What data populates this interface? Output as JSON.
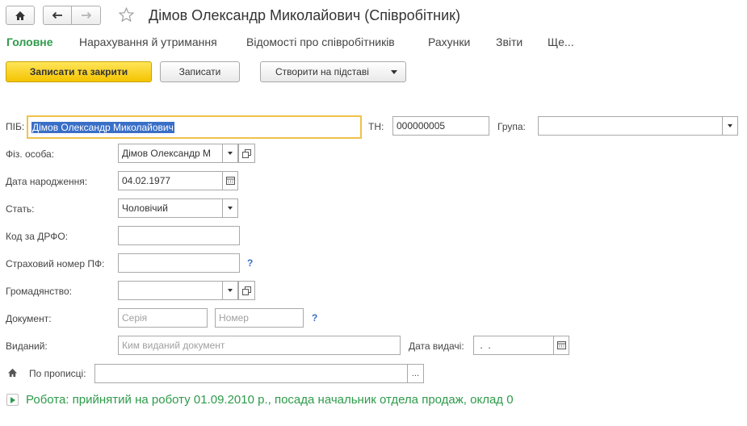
{
  "window": {
    "title": "Дімов Олександр Миколайович (Співробітник)"
  },
  "tabs": [
    {
      "label": "Головне",
      "active": true
    },
    {
      "label": "Нарахування й утримання"
    },
    {
      "label": "Відомості про співробітників"
    },
    {
      "label": "Рахунки"
    },
    {
      "label": "Звіти"
    },
    {
      "label": "Ще..."
    }
  ],
  "toolbar": {
    "save_close": "Записати та закрити",
    "save": "Записати",
    "create_based": "Створити на підставі"
  },
  "form": {
    "pib": {
      "label": "ПІБ:",
      "value": "Дімов Олександр Миколайович"
    },
    "tn": {
      "label": "ТН:",
      "value": "000000005"
    },
    "group": {
      "label": "Група:",
      "value": ""
    },
    "person": {
      "label": "Фіз. особа:",
      "value": "Дімов Олександр М"
    },
    "birth": {
      "label": "Дата народження:",
      "value": "04.02.1977"
    },
    "gender": {
      "label": "Стать:",
      "value": "Чоловічий"
    },
    "drfo": {
      "label": "Код за ДРФО:",
      "value": ""
    },
    "pf": {
      "label": "Страховий номер ПФ:",
      "value": "",
      "help": "?"
    },
    "citizenship": {
      "label": "Громадянство:",
      "value": ""
    },
    "document": {
      "label": "Документ:",
      "series_placeholder": "Серія",
      "number_placeholder": "Номер",
      "help": "?"
    },
    "issued": {
      "label": "Виданий:",
      "placeholder": "Ким виданий документ"
    },
    "issue_date": {
      "label": "Дата видачі:",
      "value": " .  ."
    },
    "address": {
      "label": "По прописці:",
      "value": "",
      "more": "..."
    }
  },
  "footer": {
    "work_info": "Робота: прийнятий на роботу 01.09.2010 р., посада начальник отдела продаж, оклад 0"
  }
}
